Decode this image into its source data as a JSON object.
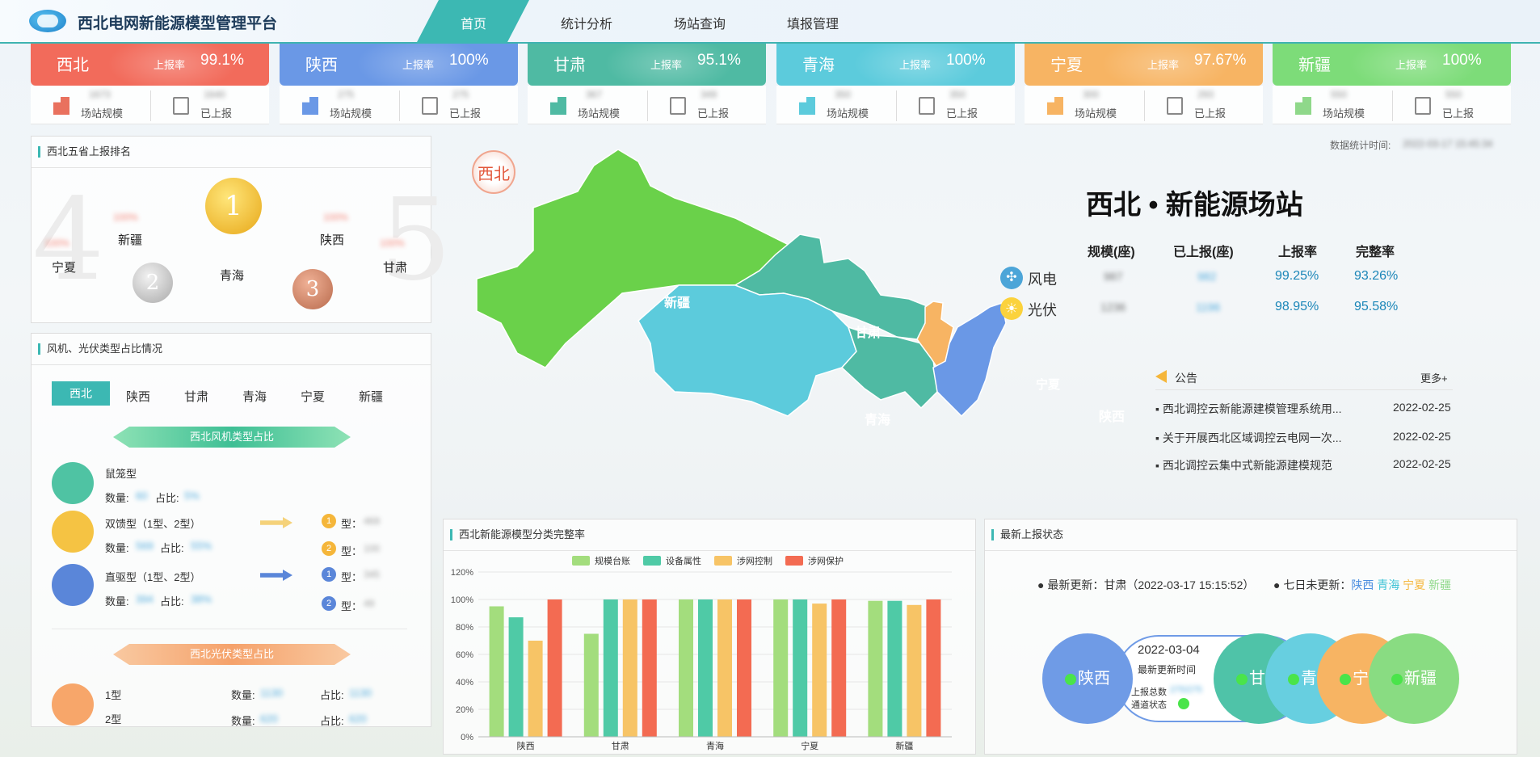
{
  "header": {
    "title": "西北电网新能源模型管理平台",
    "nav": [
      "首页",
      "统计分析",
      "场站查询",
      "填报管理"
    ]
  },
  "provinces": [
    {
      "name": "西北",
      "rate_label": "上报率",
      "rate": "99.1%",
      "scale": "1673",
      "reported": "1640",
      "scale_label": "场站规模",
      "reported_label": "已上报",
      "color": "#f26b5b",
      "icon_color": "#e9715e"
    },
    {
      "name": "陕西",
      "rate_label": "上报率",
      "rate": "100%",
      "scale": "275",
      "reported": "275",
      "scale_label": "场站规模",
      "reported_label": "已上报",
      "color": "#6a98e6",
      "icon_color": "#6a98e6"
    },
    {
      "name": "甘肃",
      "rate_label": "上报率",
      "rate": "95.1%",
      "scale": "367",
      "reported": "349",
      "scale_label": "场站规模",
      "reported_label": "已上报",
      "color": "#4fbaa3",
      "icon_color": "#4fbaa3"
    },
    {
      "name": "青海",
      "rate_label": "上报率",
      "rate": "100%",
      "scale": "350",
      "reported": "350",
      "scale_label": "场站规模",
      "reported_label": "已上报",
      "color": "#5ccbdc",
      "icon_color": "#5ccbdc"
    },
    {
      "name": "宁夏",
      "rate_label": "上报率",
      "rate": "97.67%",
      "scale": "300",
      "reported": "293",
      "scale_label": "场站规模",
      "reported_label": "已上报",
      "color": "#f7b463",
      "icon_color": "#f7b463"
    },
    {
      "name": "新疆",
      "rate_label": "上报率",
      "rate": "100%",
      "scale": "550",
      "reported": "550",
      "scale_label": "场站规模",
      "reported_label": "已上报",
      "color": "#7ddc79",
      "icon_color": "#8fd88a"
    }
  ],
  "ranking": {
    "title": "西北五省上报排名",
    "names": [
      "宁夏",
      "新疆",
      "青海",
      "陕西",
      "甘肃"
    ],
    "values": [
      "100%",
      "100%",
      "100%",
      "100%",
      "100%"
    ],
    "medals": [
      "1",
      "2",
      "3"
    ],
    "bg_numbers": [
      "4",
      "5"
    ]
  },
  "types": {
    "title": "风机、光伏类型占比情况",
    "tabs": [
      "西北",
      "陕西",
      "甘肃",
      "青海",
      "宁夏",
      "新疆"
    ],
    "wind_ribbon": "西北风机类型占比",
    "pv_ribbon": "西北光伏类型占比",
    "wind": [
      {
        "name": "鼠笼型",
        "count_label": "数量:",
        "count": "60",
        "ratio_label": "占比:",
        "ratio": "5%",
        "color": "#4fc3a3"
      },
      {
        "name": "双馈型（1型、2型）",
        "count_label": "数量:",
        "count": "569",
        "ratio_label": "占比:",
        "ratio": "55%",
        "color": "#f5c343"
      },
      {
        "name": "直驱型（1型、2型）",
        "count_label": "数量:",
        "count": "394",
        "ratio_label": "占比:",
        "ratio": "38%",
        "color": "#5a86d9"
      }
    ],
    "sub_items": [
      {
        "badge": "1",
        "label": "型：",
        "value": "469",
        "color": "#f5b63a"
      },
      {
        "badge": "2",
        "label": "型：",
        "value": "100",
        "color": "#f5b63a"
      },
      {
        "badge": "1",
        "label": "型：",
        "value": "345",
        "color": "#5a86d9"
      },
      {
        "badge": "2",
        "label": "型：",
        "value": "49",
        "color": "#5a86d9"
      }
    ],
    "pv": [
      {
        "name": "1型",
        "count_label": "数量:",
        "count": "1130",
        "ratio_label": "占比:",
        "ratio": "1130"
      },
      {
        "name": "2型",
        "count_label": "数量:",
        "count": "620",
        "ratio_label": "占比:",
        "ratio": "620"
      }
    ]
  },
  "map": {
    "badge": "西北",
    "regions": [
      "新疆",
      "甘肃",
      "青海",
      "宁夏",
      "陕西"
    ]
  },
  "summary": {
    "timestamp_label": "数据统计时间:",
    "timestamp": "2022-03-17 15:45:34",
    "title": "西北 • 新能源场站",
    "headers": [
      "规模(座)",
      "已上报(座)",
      "上报率",
      "完整率"
    ],
    "rows": [
      {
        "label": "风电",
        "icon": "wind-turbine-icon",
        "scale": "987",
        "reported": "982",
        "rate": "99.25%",
        "complete": "93.26%"
      },
      {
        "label": "光伏",
        "icon": "sun-icon",
        "scale": "1236",
        "reported": "1196",
        "rate": "98.95%",
        "complete": "95.58%"
      }
    ]
  },
  "notices": {
    "title": "公告",
    "more": "更多+",
    "items": [
      {
        "text": "西北调控云新能源建模管理系统用...",
        "date": "2022-02-25"
      },
      {
        "text": "关于开展西北区域调控云电网一次...",
        "date": "2022-02-25"
      },
      {
        "text": "西北调控云集中式新能源建模规范",
        "date": "2022-02-25"
      }
    ]
  },
  "chart_panel": {
    "title": "西北新能源模型分类完整率"
  },
  "chart_data": {
    "type": "bar",
    "categories": [
      "陕西",
      "甘肃",
      "青海",
      "宁夏",
      "新疆"
    ],
    "series": [
      {
        "name": "规模台账",
        "color": "#a3dd7d",
        "values": [
          95,
          75,
          100,
          100,
          99
        ]
      },
      {
        "name": "设备属性",
        "color": "#4fcaa6",
        "values": [
          87,
          100,
          100,
          100,
          99
        ]
      },
      {
        "name": "涉网控制",
        "color": "#f7c466",
        "values": [
          70,
          100,
          100,
          97,
          96
        ]
      },
      {
        "name": "涉网保护",
        "color": "#f36b52",
        "values": [
          100,
          100,
          100,
          100,
          100
        ]
      }
    ],
    "ylim": [
      0,
      120
    ],
    "yticks": [
      "0%",
      "20%",
      "40%",
      "60%",
      "80%",
      "100%",
      "120%"
    ],
    "legend": "top"
  },
  "status": {
    "title": "最新上报状态",
    "latest_label": "● 最新更新：",
    "latest_province": "甘肃",
    "latest_time": "（2022-03-17 15:15:52）",
    "stale_label": "● 七日未更新：",
    "stale": [
      "陕西",
      "青海",
      "宁夏",
      "新疆"
    ],
    "card": {
      "date": "2022-03-04",
      "time_label": "最新更新时间",
      "total_label": "上报总数",
      "total": "275/275",
      "channel_label": "通道状态"
    },
    "circles": [
      {
        "name": "陕西",
        "color": "#6f9be6"
      },
      {
        "name": "甘肃",
        "color": "#4fc3a8"
      },
      {
        "name": "青海",
        "color": "#67cfe0"
      },
      {
        "name": "宁夏",
        "color": "#f7b463"
      },
      {
        "name": "新疆",
        "color": "#89dc82"
      }
    ]
  }
}
